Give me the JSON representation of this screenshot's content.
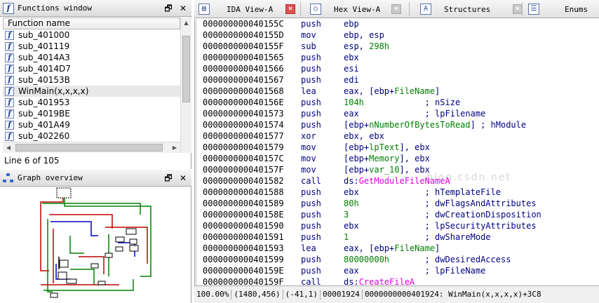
{
  "functions_window": {
    "title": "Functions window",
    "column_header": "Function name",
    "items": [
      {
        "name": "sub_401000",
        "selected": false
      },
      {
        "name": "sub_401119",
        "selected": false
      },
      {
        "name": "sub_4014A3",
        "selected": false
      },
      {
        "name": "sub_4014D7",
        "selected": false
      },
      {
        "name": "sub_40153B",
        "selected": false
      },
      {
        "name": "WinMain(x,x,x,x)",
        "selected": true
      },
      {
        "name": "sub_401953",
        "selected": false
      },
      {
        "name": "sub_4019BE",
        "selected": false
      },
      {
        "name": "sub_401A49",
        "selected": false
      },
      {
        "name": "sub_402260",
        "selected": false
      }
    ],
    "status": "Line 6 of 105"
  },
  "graph_overview": {
    "title": "Graph overview"
  },
  "tabs": [
    {
      "label": "IDA View-A",
      "icon": "ida-view-icon",
      "active": true
    },
    {
      "label": "Hex View-A",
      "icon": "hex-view-icon",
      "active": false
    },
    {
      "label": "Structures",
      "icon": "structures-icon",
      "active": false
    },
    {
      "label": "Enums",
      "icon": "enums-icon",
      "active": false
    }
  ],
  "watermark": "blog.csdn.net",
  "disasm": [
    {
      "addr": "000000000040155C",
      "mnem": "push",
      "ops": [
        {
          "t": "ebp",
          "c": "blk"
        }
      ]
    },
    {
      "addr": "000000000040155D",
      "mnem": "mov",
      "ops": [
        {
          "t": "ebp, esp",
          "c": "blk"
        }
      ]
    },
    {
      "addr": "000000000040155F",
      "mnem": "sub",
      "ops": [
        {
          "t": "esp, ",
          "c": "blk"
        },
        {
          "t": "298h",
          "c": "num"
        }
      ]
    },
    {
      "addr": "0000000000401565",
      "mnem": "push",
      "ops": [
        {
          "t": "ebx",
          "c": "blk"
        }
      ]
    },
    {
      "addr": "0000000000401566",
      "mnem": "push",
      "ops": [
        {
          "t": "esi",
          "c": "blk"
        }
      ]
    },
    {
      "addr": "0000000000401567",
      "mnem": "push",
      "ops": [
        {
          "t": "edi",
          "c": "blk"
        }
      ]
    },
    {
      "addr": "0000000000401568",
      "mnem": "lea",
      "ops": [
        {
          "t": "eax, [ebp+",
          "c": "blk"
        },
        {
          "t": "FileName",
          "c": "var"
        },
        {
          "t": "]",
          "c": "blk"
        }
      ]
    },
    {
      "addr": "000000000040156E",
      "mnem": "push",
      "ops": [
        {
          "t": "104h",
          "c": "num"
        },
        {
          "t": "            ; nSize",
          "c": "cmt"
        }
      ]
    },
    {
      "addr": "0000000000401573",
      "mnem": "push",
      "ops": [
        {
          "t": "eax",
          "c": "blk"
        },
        {
          "t": "             ; lpFilename",
          "c": "cmt"
        }
      ]
    },
    {
      "addr": "0000000000401574",
      "mnem": "push",
      "ops": [
        {
          "t": "[ebp+",
          "c": "blk"
        },
        {
          "t": "nNumberOfBytesToRead",
          "c": "var"
        },
        {
          "t": "] ; hModule",
          "c": "cmt"
        }
      ]
    },
    {
      "addr": "0000000000401577",
      "mnem": "xor",
      "ops": [
        {
          "t": "ebx, ebx",
          "c": "blk"
        }
      ]
    },
    {
      "addr": "0000000000401579",
      "mnem": "mov",
      "ops": [
        {
          "t": "[ebp+",
          "c": "blk"
        },
        {
          "t": "lpText",
          "c": "var"
        },
        {
          "t": "], ebx",
          "c": "blk"
        }
      ]
    },
    {
      "addr": "000000000040157C",
      "mnem": "mov",
      "ops": [
        {
          "t": "[ebp+",
          "c": "blk"
        },
        {
          "t": "Memory",
          "c": "var"
        },
        {
          "t": "], ebx",
          "c": "blk"
        }
      ]
    },
    {
      "addr": "000000000040157F",
      "mnem": "mov",
      "ops": [
        {
          "t": "[ebp+",
          "c": "blk"
        },
        {
          "t": "var_10",
          "c": "var"
        },
        {
          "t": "], ebx",
          "c": "blk"
        }
      ]
    },
    {
      "addr": "0000000000401582",
      "mnem": "call",
      "ops": [
        {
          "t": "ds:",
          "c": "blk"
        },
        {
          "t": "GetModuleFileNameA",
          "c": "mag"
        }
      ]
    },
    {
      "addr": "0000000000401588",
      "mnem": "push",
      "ops": [
        {
          "t": "ebx",
          "c": "blk"
        },
        {
          "t": "             ; hTemplateFile",
          "c": "cmt"
        }
      ]
    },
    {
      "addr": "0000000000401589",
      "mnem": "push",
      "ops": [
        {
          "t": "80h",
          "c": "num"
        },
        {
          "t": "             ; dwFlagsAndAttributes",
          "c": "cmt"
        }
      ]
    },
    {
      "addr": "000000000040158E",
      "mnem": "push",
      "ops": [
        {
          "t": "3",
          "c": "num"
        },
        {
          "t": "               ; dwCreationDisposition",
          "c": "cmt"
        }
      ]
    },
    {
      "addr": "0000000000401590",
      "mnem": "push",
      "ops": [
        {
          "t": "ebx",
          "c": "blk"
        },
        {
          "t": "             ; lpSecurityAttributes",
          "c": "cmt"
        }
      ]
    },
    {
      "addr": "0000000000401591",
      "mnem": "push",
      "ops": [
        {
          "t": "1",
          "c": "num"
        },
        {
          "t": "               ; dwShareMode",
          "c": "cmt"
        }
      ]
    },
    {
      "addr": "0000000000401593",
      "mnem": "lea",
      "ops": [
        {
          "t": "eax, [ebp+",
          "c": "blk"
        },
        {
          "t": "FileName",
          "c": "var"
        },
        {
          "t": "]",
          "c": "blk"
        }
      ]
    },
    {
      "addr": "0000000000401599",
      "mnem": "push",
      "ops": [
        {
          "t": "80000000h",
          "c": "num"
        },
        {
          "t": "       ; dwDesiredAccess",
          "c": "cmt"
        }
      ]
    },
    {
      "addr": "000000000040159E",
      "mnem": "push",
      "ops": [
        {
          "t": "eax",
          "c": "blk"
        },
        {
          "t": "             ; lpFileName",
          "c": "cmt"
        }
      ]
    },
    {
      "addr": "000000000040159F",
      "mnem": "call",
      "ops": [
        {
          "t": "ds:",
          "c": "blk"
        },
        {
          "t": "CreateFileA",
          "c": "mag"
        }
      ]
    }
  ],
  "statusbar": {
    "zoom": "100.00%",
    "graph_coords": "(1480,456)",
    "cursor_pos": "(-41,1)",
    "file_offset": "00001924",
    "location": "0000000000401924: WinMain(x,x,x,x)+3C8"
  },
  "colors": {
    "address": "#000000",
    "mnemonic": "#000080",
    "immediate": "#008000",
    "import_name": "#e000e0",
    "comment": "#000080",
    "close_active": "#e05050"
  }
}
